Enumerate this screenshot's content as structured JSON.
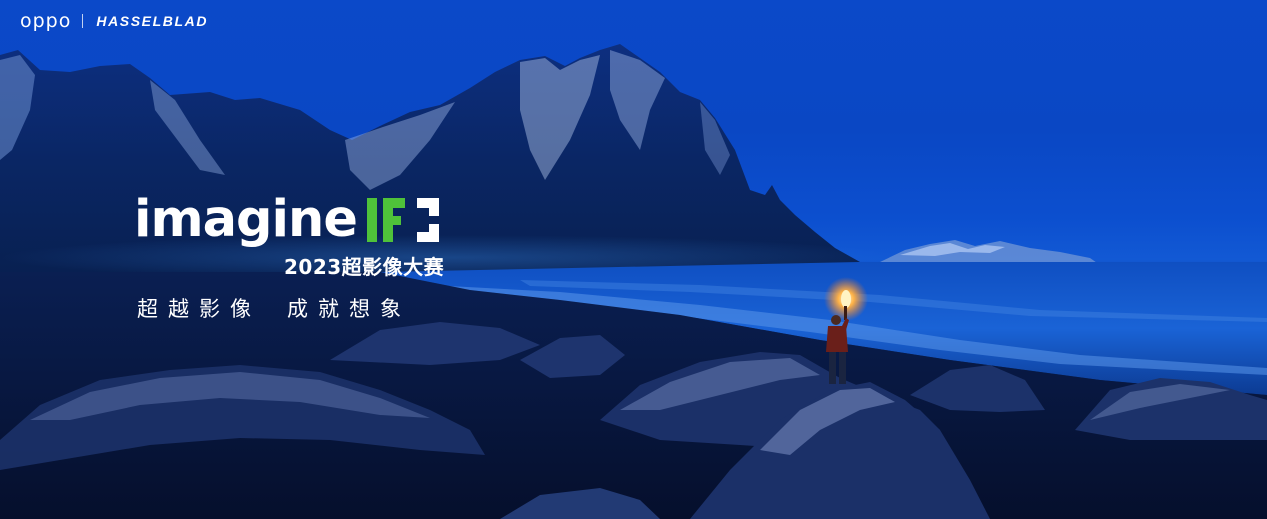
{
  "brand": {
    "oppo": "oppo",
    "hasselblad": "HASSELBLAD"
  },
  "campaign": {
    "headline": "imagine",
    "mark_icon": "if-bracket-logo-icon",
    "contest": "2023超影像大赛"
  },
  "slogan": {
    "part1": "超越影像",
    "part2": "成就想象"
  },
  "colors": {
    "mark_green": "#4fc23a",
    "mark_white": "#ffffff",
    "sky_blue": "#0b49c9",
    "torch_orange": "#ffb347"
  }
}
